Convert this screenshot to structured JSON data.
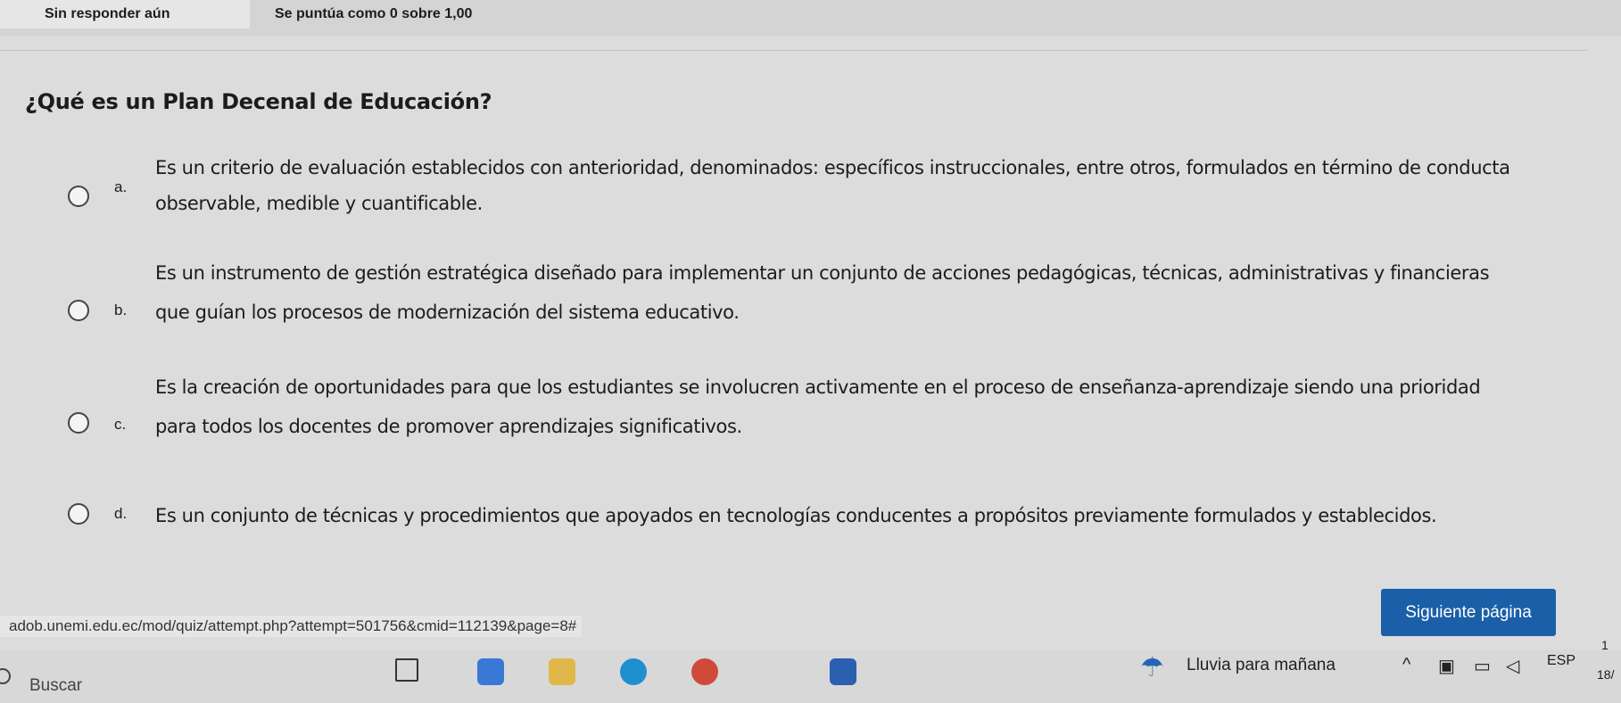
{
  "quiz_info": {
    "status": "Sin responder aún",
    "points": "Se puntúa como 0 sobre 1,00"
  },
  "question": {
    "text": "¿Qué es un Plan Decenal de Educación?",
    "options": [
      {
        "letter": "a.",
        "line1": "Es un criterio de evaluación establecidos con anterioridad, denominados: específicos instruccionales, entre otros, formulados en término de conducta",
        "line2": "observable, medible y cuantificable."
      },
      {
        "letter": "b.",
        "line1": "Es un instrumento de gestión estratégica diseñado para implementar un conjunto de acciones pedagógicas, técnicas, administrativas y financieras",
        "line2": "que guían los procesos de modernización del sistema educativo."
      },
      {
        "letter": "c.",
        "line1": "Es la creación de oportunidades para que los estudiantes se involucren activamente en el proceso de enseñanza-aprendizaje siendo una prioridad",
        "line2": "para todos los docentes de promover aprendizajes significativos."
      },
      {
        "letter": "d.",
        "line1": "Es un conjunto de técnicas y procedimientos que apoyados en tecnologías conducentes a propósitos previamente formulados y establecidos.",
        "line2": ""
      }
    ]
  },
  "status_url": "adob.unemi.edu.ec/mod/quiz/attempt.php?attempt=501756&cmid=112139&page=8#",
  "next_button": "Siguiente página",
  "taskbar": {
    "search_label": "Buscar",
    "weather_text": "Lluvia para mañana",
    "language": "ESP",
    "time_partial": "1",
    "date_partial": "18/"
  },
  "icons": {
    "radio": "radio-button",
    "search": "search-icon",
    "weather": "rain-cloud-icon"
  }
}
